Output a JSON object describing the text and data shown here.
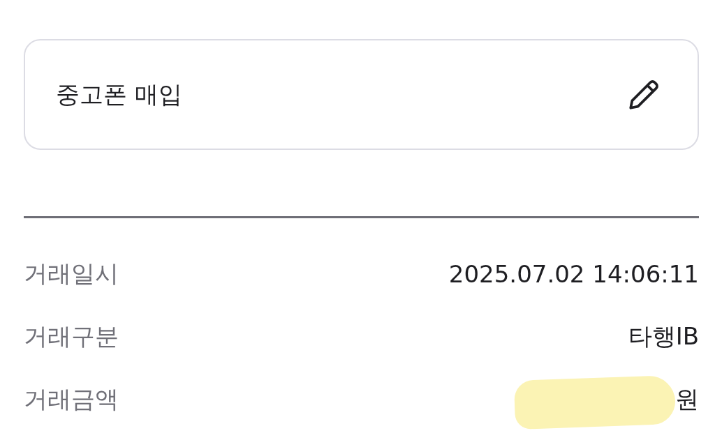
{
  "memo": {
    "value": "중고폰 매입"
  },
  "details": [
    {
      "label": "거래일시",
      "value": "2025.07.02 14:06:11",
      "redacted": false
    },
    {
      "label": "거래구분",
      "value": "타행IB",
      "redacted": false
    },
    {
      "label": "거래금액",
      "value": "원",
      "redacted": true
    }
  ]
}
